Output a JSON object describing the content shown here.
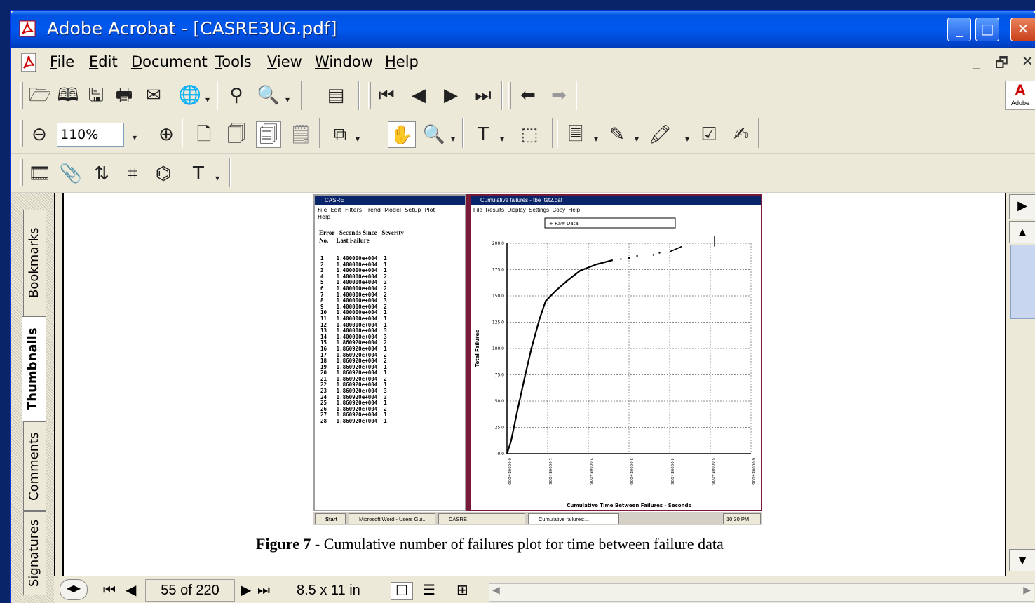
{
  "window": {
    "title": "Adobe Acrobat - [CASRE3UG.pdf]",
    "controls": {
      "minimize": "_",
      "maximize": "□",
      "close": "✕"
    }
  },
  "menubar": {
    "items": [
      {
        "label": "File",
        "underline": "F"
      },
      {
        "label": "Edit",
        "underline": "E"
      },
      {
        "label": "Document",
        "underline": "D"
      },
      {
        "label": "Tools",
        "underline": "T"
      },
      {
        "label": "View",
        "underline": "V"
      },
      {
        "label": "Window",
        "underline": "W"
      },
      {
        "label": "Help",
        "underline": "H"
      }
    ],
    "mdi_controls": {
      "minimize": "_",
      "restore": "🗗",
      "close": "✕"
    }
  },
  "toolbar": {
    "zoom_value": "110%",
    "adobe_logo": "Adobe"
  },
  "sidebar": {
    "tabs": [
      {
        "label": "Bookmarks",
        "active": false
      },
      {
        "label": "Thumbnails",
        "active": true
      },
      {
        "label": "Comments",
        "active": false
      },
      {
        "label": "Signatures",
        "active": false
      }
    ]
  },
  "document": {
    "figure_caption_bold": "Figure 7",
    "figure_caption_rest": " - Cumulative number of failures plot for time between failure data",
    "screenshot": {
      "left_window_title": "CASRE",
      "left_menu": "File  Edit  Filters  Trend  Model  Setup  Plot\nHelp",
      "left_header": "Error   Seconds Since   Severity\nNo.     Last Failure",
      "rows": [
        {
          "n": "1",
          "v": "1.400000e+004",
          "s": "1"
        },
        {
          "n": "2",
          "v": "1.400000e+004",
          "s": "1"
        },
        {
          "n": "3",
          "v": "1.400000e+004",
          "s": "1"
        },
        {
          "n": "4",
          "v": "1.400000e+004",
          "s": "2"
        },
        {
          "n": "5",
          "v": "1.400000e+004",
          "s": "3"
        },
        {
          "n": "6",
          "v": "1.400000e+004",
          "s": "2"
        },
        {
          "n": "7",
          "v": "1.400000e+004",
          "s": "2"
        },
        {
          "n": "8",
          "v": "1.400000e+004",
          "s": "3"
        },
        {
          "n": "9",
          "v": "1.400000e+004",
          "s": "2"
        },
        {
          "n": "10",
          "v": "1.400000e+004",
          "s": "1"
        },
        {
          "n": "11",
          "v": "1.400000e+004",
          "s": "1"
        },
        {
          "n": "12",
          "v": "1.400000e+004",
          "s": "1"
        },
        {
          "n": "13",
          "v": "1.400000e+004",
          "s": "3"
        },
        {
          "n": "14",
          "v": "1.400000e+004",
          "s": "3"
        },
        {
          "n": "15",
          "v": "1.860920e+004",
          "s": "2"
        },
        {
          "n": "16",
          "v": "1.860920e+004",
          "s": "1"
        },
        {
          "n": "17",
          "v": "1.860920e+004",
          "s": "2"
        },
        {
          "n": "18",
          "v": "1.860920e+004",
          "s": "2"
        },
        {
          "n": "19",
          "v": "1.860920e+004",
          "s": "1"
        },
        {
          "n": "20",
          "v": "1.860920e+004",
          "s": "1"
        },
        {
          "n": "21",
          "v": "1.860920e+004",
          "s": "2"
        },
        {
          "n": "22",
          "v": "1.860920e+004",
          "s": "1"
        },
        {
          "n": "23",
          "v": "1.860920e+004",
          "s": "3"
        },
        {
          "n": "24",
          "v": "1.860920e+004",
          "s": "3"
        },
        {
          "n": "25",
          "v": "1.860920e+004",
          "s": "1"
        },
        {
          "n": "26",
          "v": "1.860920e+004",
          "s": "2"
        },
        {
          "n": "27",
          "v": "1.860920e+004",
          "s": "1"
        },
        {
          "n": "28",
          "v": "1.860920e+004",
          "s": "1"
        }
      ],
      "right_window_title": "Cumulative failures - tbe_tst2.dat",
      "right_menu": "File  Results  Display  Settings  Copy  Help",
      "legend": "+ Raw Data",
      "x_axis_label": "Cumulative Time Between Failures - Seconds",
      "y_axis_label": "Total Failures",
      "y_ticks": [
        "0.0",
        "25.0",
        "50.0",
        "75.0",
        "100.0",
        "125.0",
        "150.0",
        "175.0",
        "200.0"
      ],
      "x_ticks": [
        "0.0000E+000",
        "1.0000E+006",
        "2.0000E+006",
        "3.0000E+006",
        "4.0000E+006",
        "5.0000E+006",
        "6.0000E+006"
      ],
      "taskbar": {
        "start": "Start",
        "tasks": [
          "Microsoft Word - Users Gui...",
          "CASRE",
          "Cumulative failures:..."
        ],
        "clock": "10:30 PM"
      }
    }
  },
  "statusbar": {
    "page": "55 of 220",
    "page_size": "8.5 x 11 in"
  },
  "icons": {
    "open": "open-folder-icon",
    "print": "printer-icon",
    "search": "binoculars-icon",
    "hand": "hand-tool-icon",
    "zoom": "zoom-in-icon"
  }
}
